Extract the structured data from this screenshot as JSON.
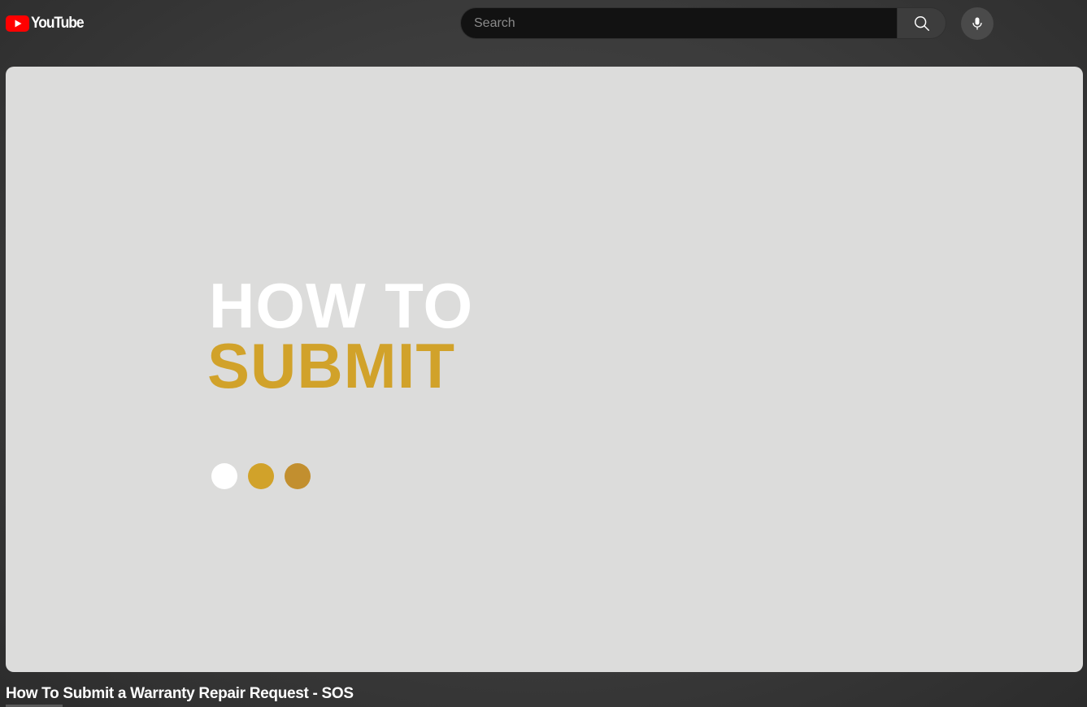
{
  "header": {
    "logo_text": "YouTube",
    "search": {
      "placeholder": "Search"
    },
    "icons": {
      "logo": "youtube-play-logo-icon",
      "search": "search-icon",
      "mic": "microphone-icon"
    }
  },
  "video": {
    "line1": "HOW TO",
    "line2": "SUBMIT",
    "title": "How To Submit a Warranty Repair Request - SOS"
  },
  "colors": {
    "brand_red": "#ff0000",
    "gold": "#d1a22a",
    "dot_white": "#ffffff",
    "dot_gold": "#d1a22a",
    "dot_bronze": "#c28f2f"
  }
}
